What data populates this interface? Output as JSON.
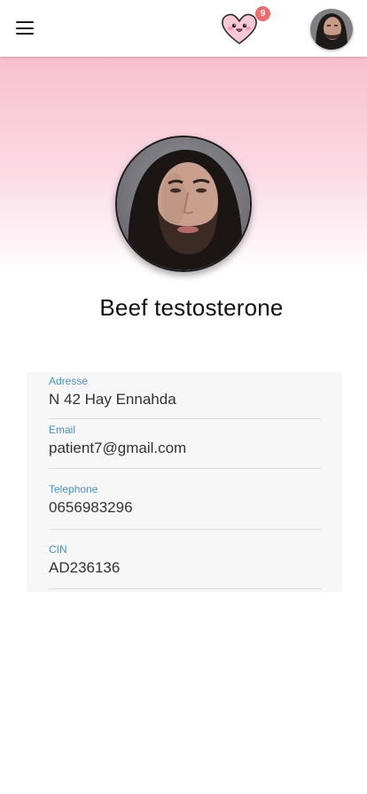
{
  "app": {
    "notification_count": "9"
  },
  "profile": {
    "name": "Beef testosterone"
  },
  "fields": [
    {
      "label": "Adresse",
      "value": "N 42 Hay Ennahda"
    },
    {
      "label": "Email",
      "value": "patient7@gmail.com"
    },
    {
      "label": "Telephone",
      "value": "0656983296"
    },
    {
      "label": "CIN",
      "value": "AD236136"
    }
  ],
  "icons": {
    "menu": "hamburger-menu-icon",
    "logo": "kawaii-heart-icon",
    "avatar": "user-avatar"
  },
  "colors": {
    "header_gradient_top": "#f7bfcf",
    "badge": "#f06b6b",
    "field_label": "#4a90c8",
    "card_bg": "#f7f7f7"
  }
}
